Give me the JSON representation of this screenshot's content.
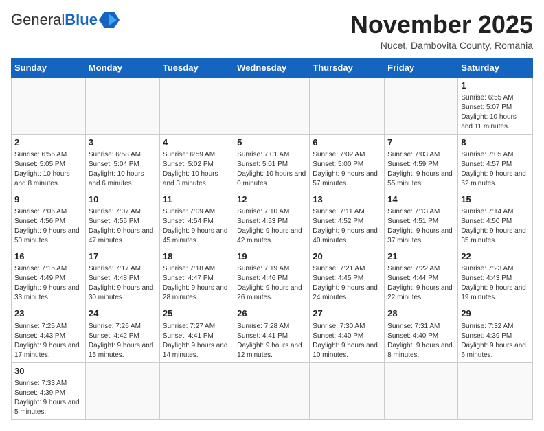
{
  "header": {
    "logo_general": "General",
    "logo_blue": "Blue",
    "month_title": "November 2025",
    "location": "Nucet, Dambovita County, Romania"
  },
  "weekdays": [
    "Sunday",
    "Monday",
    "Tuesday",
    "Wednesday",
    "Thursday",
    "Friday",
    "Saturday"
  ],
  "weeks": [
    [
      {
        "day": "",
        "info": ""
      },
      {
        "day": "",
        "info": ""
      },
      {
        "day": "",
        "info": ""
      },
      {
        "day": "",
        "info": ""
      },
      {
        "day": "",
        "info": ""
      },
      {
        "day": "",
        "info": ""
      },
      {
        "day": "1",
        "info": "Sunrise: 6:55 AM\nSunset: 5:07 PM\nDaylight: 10 hours and 11 minutes."
      }
    ],
    [
      {
        "day": "2",
        "info": "Sunrise: 6:56 AM\nSunset: 5:05 PM\nDaylight: 10 hours and 8 minutes."
      },
      {
        "day": "3",
        "info": "Sunrise: 6:58 AM\nSunset: 5:04 PM\nDaylight: 10 hours and 6 minutes."
      },
      {
        "day": "4",
        "info": "Sunrise: 6:59 AM\nSunset: 5:02 PM\nDaylight: 10 hours and 3 minutes."
      },
      {
        "day": "5",
        "info": "Sunrise: 7:01 AM\nSunset: 5:01 PM\nDaylight: 10 hours and 0 minutes."
      },
      {
        "day": "6",
        "info": "Sunrise: 7:02 AM\nSunset: 5:00 PM\nDaylight: 9 hours and 57 minutes."
      },
      {
        "day": "7",
        "info": "Sunrise: 7:03 AM\nSunset: 4:59 PM\nDaylight: 9 hours and 55 minutes."
      },
      {
        "day": "8",
        "info": "Sunrise: 7:05 AM\nSunset: 4:57 PM\nDaylight: 9 hours and 52 minutes."
      }
    ],
    [
      {
        "day": "9",
        "info": "Sunrise: 7:06 AM\nSunset: 4:56 PM\nDaylight: 9 hours and 50 minutes."
      },
      {
        "day": "10",
        "info": "Sunrise: 7:07 AM\nSunset: 4:55 PM\nDaylight: 9 hours and 47 minutes."
      },
      {
        "day": "11",
        "info": "Sunrise: 7:09 AM\nSunset: 4:54 PM\nDaylight: 9 hours and 45 minutes."
      },
      {
        "day": "12",
        "info": "Sunrise: 7:10 AM\nSunset: 4:53 PM\nDaylight: 9 hours and 42 minutes."
      },
      {
        "day": "13",
        "info": "Sunrise: 7:11 AM\nSunset: 4:52 PM\nDaylight: 9 hours and 40 minutes."
      },
      {
        "day": "14",
        "info": "Sunrise: 7:13 AM\nSunset: 4:51 PM\nDaylight: 9 hours and 37 minutes."
      },
      {
        "day": "15",
        "info": "Sunrise: 7:14 AM\nSunset: 4:50 PM\nDaylight: 9 hours and 35 minutes."
      }
    ],
    [
      {
        "day": "16",
        "info": "Sunrise: 7:15 AM\nSunset: 4:49 PM\nDaylight: 9 hours and 33 minutes."
      },
      {
        "day": "17",
        "info": "Sunrise: 7:17 AM\nSunset: 4:48 PM\nDaylight: 9 hours and 30 minutes."
      },
      {
        "day": "18",
        "info": "Sunrise: 7:18 AM\nSunset: 4:47 PM\nDaylight: 9 hours and 28 minutes."
      },
      {
        "day": "19",
        "info": "Sunrise: 7:19 AM\nSunset: 4:46 PM\nDaylight: 9 hours and 26 minutes."
      },
      {
        "day": "20",
        "info": "Sunrise: 7:21 AM\nSunset: 4:45 PM\nDaylight: 9 hours and 24 minutes."
      },
      {
        "day": "21",
        "info": "Sunrise: 7:22 AM\nSunset: 4:44 PM\nDaylight: 9 hours and 22 minutes."
      },
      {
        "day": "22",
        "info": "Sunrise: 7:23 AM\nSunset: 4:43 PM\nDaylight: 9 hours and 19 minutes."
      }
    ],
    [
      {
        "day": "23",
        "info": "Sunrise: 7:25 AM\nSunset: 4:43 PM\nDaylight: 9 hours and 17 minutes."
      },
      {
        "day": "24",
        "info": "Sunrise: 7:26 AM\nSunset: 4:42 PM\nDaylight: 9 hours and 15 minutes."
      },
      {
        "day": "25",
        "info": "Sunrise: 7:27 AM\nSunset: 4:41 PM\nDaylight: 9 hours and 14 minutes."
      },
      {
        "day": "26",
        "info": "Sunrise: 7:28 AM\nSunset: 4:41 PM\nDaylight: 9 hours and 12 minutes."
      },
      {
        "day": "27",
        "info": "Sunrise: 7:30 AM\nSunset: 4:40 PM\nDaylight: 9 hours and 10 minutes."
      },
      {
        "day": "28",
        "info": "Sunrise: 7:31 AM\nSunset: 4:40 PM\nDaylight: 9 hours and 8 minutes."
      },
      {
        "day": "29",
        "info": "Sunrise: 7:32 AM\nSunset: 4:39 PM\nDaylight: 9 hours and 6 minutes."
      }
    ],
    [
      {
        "day": "30",
        "info": "Sunrise: 7:33 AM\nSunset: 4:39 PM\nDaylight: 9 hours and 5 minutes."
      },
      {
        "day": "",
        "info": ""
      },
      {
        "day": "",
        "info": ""
      },
      {
        "day": "",
        "info": ""
      },
      {
        "day": "",
        "info": ""
      },
      {
        "day": "",
        "info": ""
      },
      {
        "day": "",
        "info": ""
      }
    ]
  ]
}
